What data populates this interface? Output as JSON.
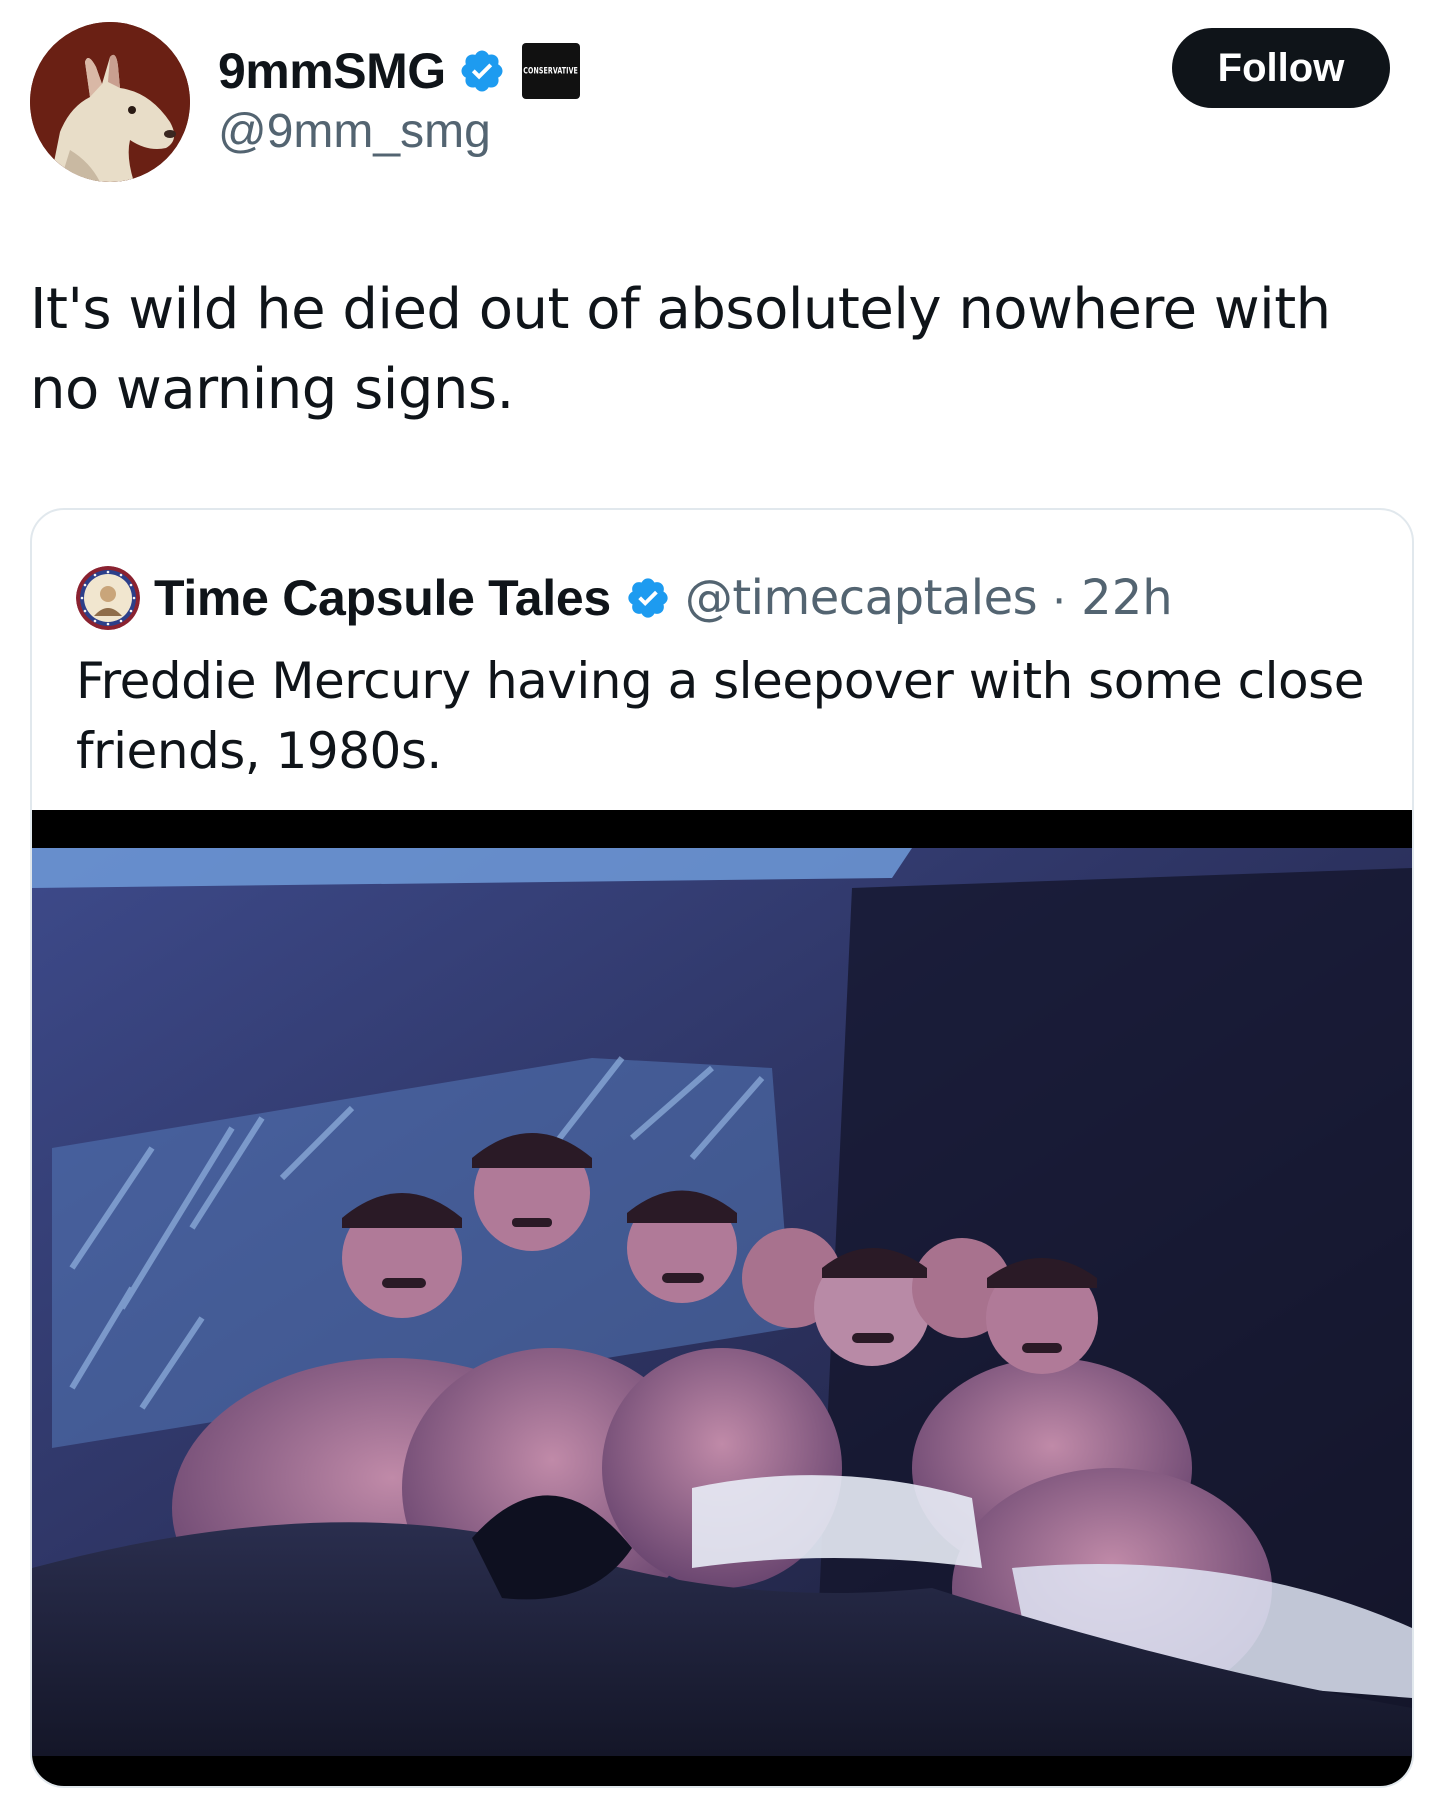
{
  "author": {
    "display_name": "9mmSMG",
    "handle": "@9mm_smg",
    "avatar_icon": "bull-terrier-portrait",
    "verified_icon": "verified-badge-icon",
    "affiliate_badge_text": "CONSERVATIVE"
  },
  "follow_button": {
    "label": "Follow"
  },
  "post": {
    "text": "It's wild he died out of absolutely nowhere with no warning signs."
  },
  "quoted_post": {
    "display_name": "Time Capsule Tales",
    "handle": "@timecaptales",
    "separator": "·",
    "time": "22h",
    "text": "Freddie Mercury having a sleepover with some close friends, 1980s.",
    "avatar_icon": "portrait-coin-avatar",
    "photo_description_icon": "group-photo"
  },
  "colors": {
    "accent_verified": "#1d9bf0",
    "text_primary": "#0f1419",
    "text_secondary": "#536471",
    "follow_bg": "#0f1419"
  }
}
